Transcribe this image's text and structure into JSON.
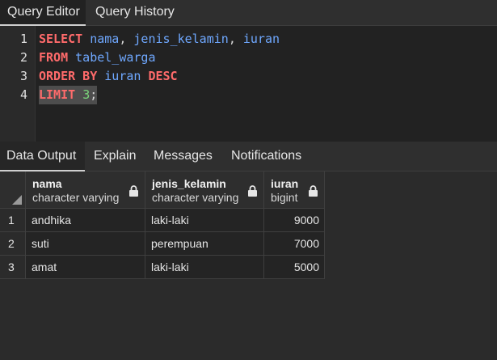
{
  "editor_tabs": [
    "Query Editor",
    "Query History"
  ],
  "editor": {
    "line_numbers": [
      "1",
      "2",
      "3",
      "4"
    ],
    "lines": [
      [
        {
          "t": "SELECT",
          "c": "kw"
        },
        {
          "t": " ",
          "c": "pn"
        },
        {
          "t": "nama",
          "c": "id"
        },
        {
          "t": ", ",
          "c": "pn"
        },
        {
          "t": "jenis_kelamin",
          "c": "id"
        },
        {
          "t": ", ",
          "c": "pn"
        },
        {
          "t": "iuran",
          "c": "id"
        }
      ],
      [
        {
          "t": "FROM",
          "c": "kw"
        },
        {
          "t": " ",
          "c": "pn"
        },
        {
          "t": "tabel_warga",
          "c": "id"
        }
      ],
      [
        {
          "t": "ORDER BY",
          "c": "kw"
        },
        {
          "t": " ",
          "c": "pn"
        },
        {
          "t": "iuran",
          "c": "id"
        },
        {
          "t": " ",
          "c": "pn"
        },
        {
          "t": "DESC",
          "c": "kw"
        }
      ],
      [
        {
          "t": "LIMIT",
          "c": "kw"
        },
        {
          "t": " ",
          "c": "pn"
        },
        {
          "t": "3",
          "c": "num"
        },
        {
          "t": ";",
          "c": "pn"
        }
      ]
    ]
  },
  "output_tabs": [
    "Data Output",
    "Explain",
    "Messages",
    "Notifications"
  ],
  "grid": {
    "columns": [
      {
        "name": "nama",
        "type": "character varying"
      },
      {
        "name": "jenis_kelamin",
        "type": "character varying"
      },
      {
        "name": "iuran",
        "type": "bigint"
      }
    ],
    "rows": [
      {
        "num": "1",
        "cells": [
          "andhika",
          "laki-laki",
          "9000"
        ]
      },
      {
        "num": "2",
        "cells": [
          "suti",
          "perempuan",
          "7000"
        ]
      },
      {
        "num": "3",
        "cells": [
          "amat",
          "laki-laki",
          "5000"
        ]
      }
    ]
  },
  "colors": {
    "keyword": "#ff6b6b",
    "identifier": "#6fa8ff",
    "number": "#7bd67b"
  }
}
